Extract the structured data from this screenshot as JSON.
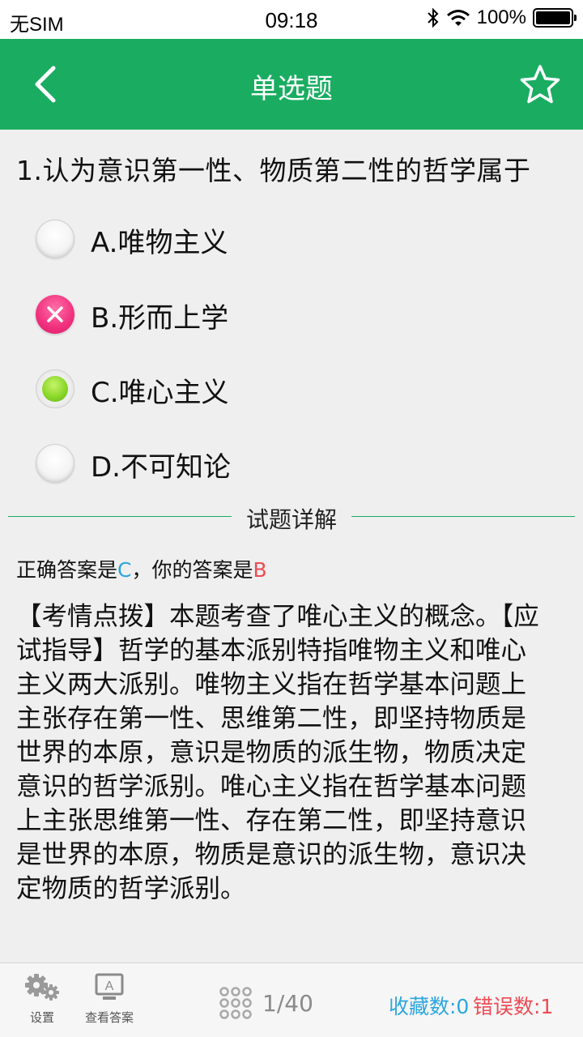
{
  "status_bar": {
    "carrier": "无SIM",
    "time": "09:18",
    "battery": "100%"
  },
  "nav": {
    "title": "单选题",
    "back_icon": "chevron-left-icon",
    "favorite_icon": "star-outline-icon"
  },
  "question": {
    "text": "1.认为意识第一性、物质第二性的哲学属于",
    "options": [
      {
        "label": "A.唯物主义",
        "state": "unselected"
      },
      {
        "label": "B.形而上学",
        "state": "wrong"
      },
      {
        "label": "C.唯心主义",
        "state": "correct"
      },
      {
        "label": "D.不可知论",
        "state": "unselected"
      }
    ]
  },
  "detail": {
    "divider_label": "试题详解",
    "correct_prefix": "正确答案是",
    "correct_answer": "C",
    "separator": "，你的答案是",
    "user_answer": "B",
    "explanation": "【考情点拨】本题考查了唯心主义的概念。【应试指导】哲学的基本派别特指唯物主义和唯心主义两大派别。唯物主义指在哲学基本问题上主张存在第一性、思维第二性，即坚持物质是世界的本原，意识是物质的派生物，物质决定意识的哲学派别。唯心主义指在哲学基本问题上主张思维第一性、存在第二性，即坚持意识是世界的本原，物质是意识的派生物，意识决定物质的哲学派别。"
  },
  "bottom_bar": {
    "settings_label": "设置",
    "view_answer_label": "查看答案",
    "progress": "1/40",
    "favorites": "收藏数:0",
    "errors": "错误数:1"
  },
  "colors": {
    "primary_green": "#1aad62",
    "correct_blue": "#2ba6de",
    "wrong_red": "#ee4b55",
    "wrong_pink": "#f0307d",
    "correct_green": "#8bd72b"
  }
}
